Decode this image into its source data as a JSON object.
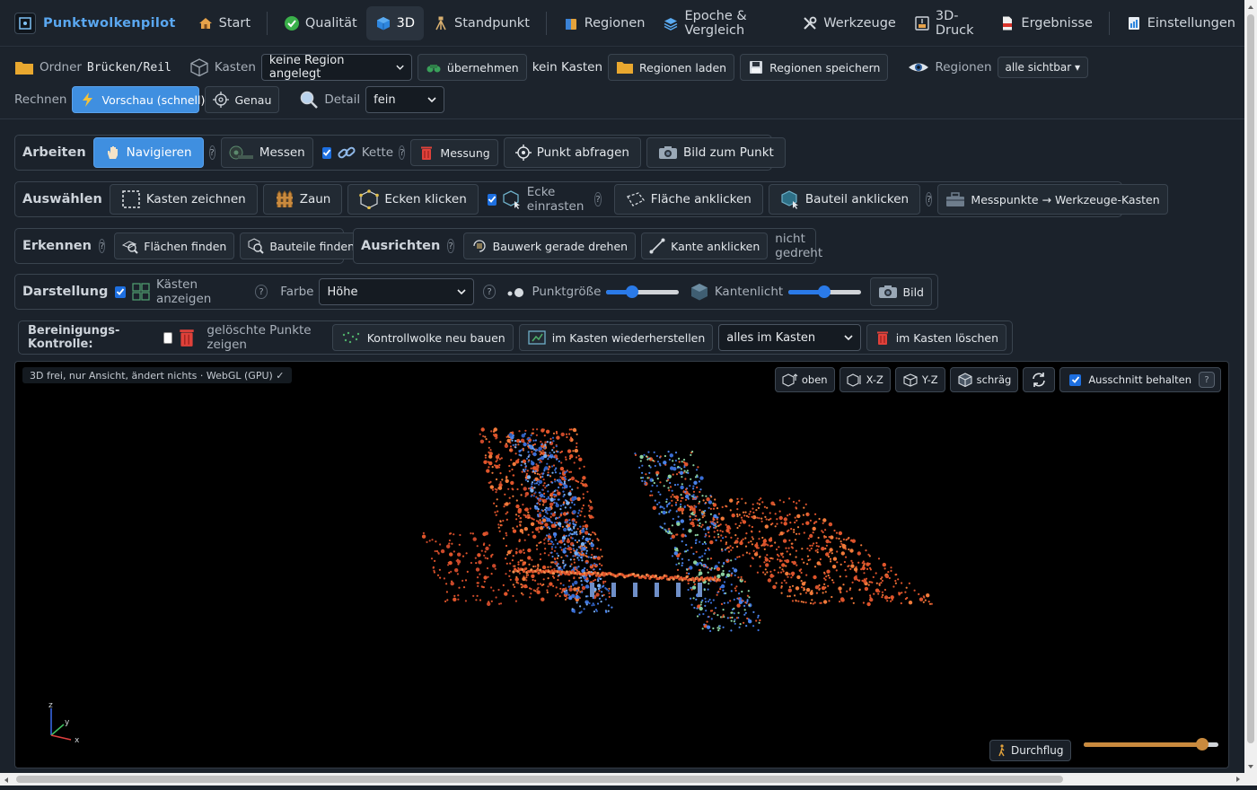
{
  "app": {
    "name": "Punktwolkenpilot"
  },
  "nav": {
    "start": "Start",
    "quality": "Qualität",
    "view3d": "3D",
    "standpoint": "Standpunkt",
    "regions": "Regionen",
    "epoch": "Epoche & Vergleich",
    "tools": "Werkzeuge",
    "print3d": "3D-Druck",
    "results": "Ergebnisse",
    "settings": "Einstellungen"
  },
  "toolbar": {
    "folder_label": "Ordner",
    "folder_value": "Brücken/Reil",
    "box_label": "Kasten",
    "box_select": "keine Region angelegt",
    "apply_button": "übernehmen",
    "box_status": "kein Kasten",
    "load_regions": "Regionen laden",
    "save_regions": "Regionen speichern",
    "regions_label": "Regionen",
    "regions_visibility": "alle sichtbar ▾",
    "compute_label": "Rechnen",
    "preview_button": "Vorschau (schnell)",
    "exact_button": "Genau",
    "detail_label": "Detail",
    "detail_select": "fein"
  },
  "work": {
    "title": "Arbeiten",
    "navigate": "Navigieren",
    "measure": "Messen",
    "chain": "Kette",
    "delete_measure": "Messung",
    "query_point": "Punkt abfragen",
    "image_point": "Bild zum Punkt"
  },
  "select": {
    "title": "Auswählen",
    "draw_box": "Kasten zeichnen",
    "fence": "Zaun",
    "click_corners": "Ecken klicken",
    "snap_corner": "Ecke einrasten",
    "click_surface": "Fläche anklicken",
    "click_part": "Bauteil anklicken",
    "points_to_box": "Messpunkte → Werkzeuge-Kasten"
  },
  "detect": {
    "title": "Erkennen",
    "find_surfaces": "Flächen finden",
    "find_parts": "Bauteile finden"
  },
  "align": {
    "title": "Ausrichten",
    "straighten": "Bauwerk gerade drehen",
    "click_edge": "Kante anklicken",
    "status": "nicht gedreht"
  },
  "display": {
    "title": "Darstellung",
    "show_boxes": "Kästen anzeigen",
    "color_label": "Farbe",
    "color_select": "Höhe",
    "point_size_label": "Punktgröße",
    "point_size": 0.33,
    "edge_light_label": "Kantenlicht",
    "edge_light": 0.5,
    "image_button": "Bild"
  },
  "cleanup": {
    "title": "Bereinigungs-Kontrolle:",
    "show_deleted": "gelöschte Punkte zeigen",
    "rebuild": "Kontrollwolke neu bauen",
    "restore": "im Kasten wiederherstellen",
    "scope_select": "alles im Kasten",
    "delete_in_box": "im Kasten löschen"
  },
  "viewer": {
    "status": "3D frei, nur Ansicht, ändert nichts · WebGL (GPU) ✓",
    "view_top": "oben",
    "view_xz": "X-Z",
    "view_yz": "Y-Z",
    "view_oblique": "schräg",
    "keep_section": "Ausschnitt behalten",
    "flythrough": "Durchflug",
    "fly_speed": 0.92,
    "axis_z": "z",
    "axis_y": "y",
    "axis_x": "x"
  },
  "colors": {
    "accent": "#3f8fe0",
    "brand": "#5aa7f0",
    "points_warm": "#e0552b",
    "points_cool": "#3a6ed6"
  }
}
